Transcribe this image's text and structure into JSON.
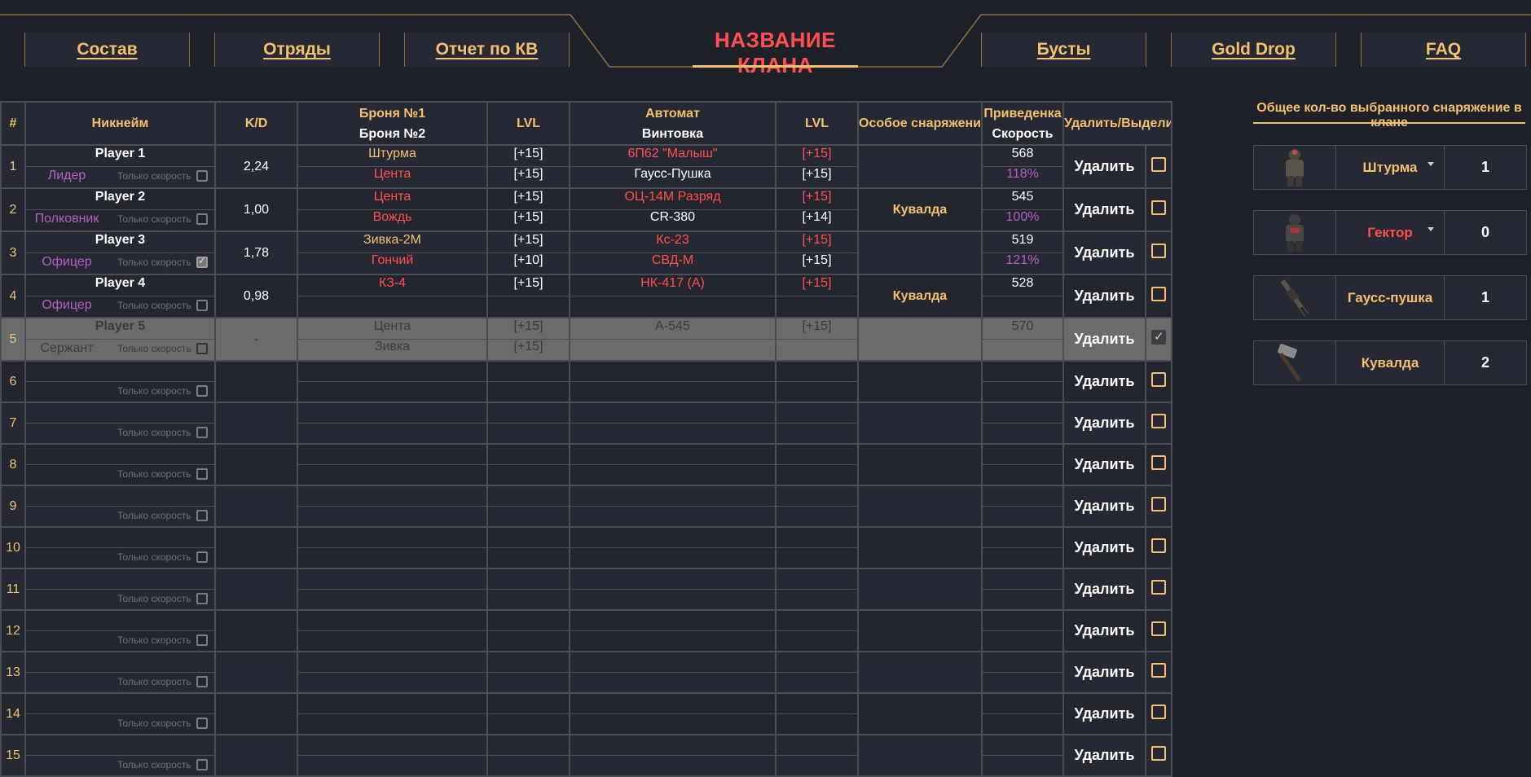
{
  "nav": {
    "tabs": [
      {
        "label": "Состав"
      },
      {
        "label": "Отряды"
      },
      {
        "label": "Отчет по КВ"
      },
      {
        "label": "Бусты"
      },
      {
        "label": "Gold Drop"
      },
      {
        "label": "FAQ"
      }
    ],
    "clan_title": "НАЗВАНИЕ КЛАНА"
  },
  "table": {
    "headers": {
      "num": "#",
      "nick": "Никнейм",
      "kd": "K/D",
      "armor1": "Броня №1",
      "armor2": "Броня №2",
      "lvl": "LVL",
      "rifle": "Автомат",
      "sniper": "Винтовка",
      "lvl2": "LVL",
      "special": "Особое снаряжение",
      "reduced": "Приведенка",
      "speed": "Скорость",
      "actions": "Удалить/Выделить"
    },
    "speed_only_label": "Только скорость",
    "delete_label": "Удалить",
    "rows": [
      {
        "num": "1",
        "name": "Player 1",
        "rank": "Лидер",
        "kd": "2,24",
        "armor1": "Штурма",
        "armor2": "Цента",
        "alvl1": "[+15]",
        "alvl2": "[+15]",
        "w1": "6П62 \"Малыш\"",
        "w2": "Гаусс-Пушка",
        "wlvl1": "[+15]",
        "wlvl2": "[+15]",
        "special": "",
        "reduced": "568",
        "speed": "118%",
        "speed_only": false,
        "selected": false
      },
      {
        "num": "2",
        "name": "Player 2",
        "rank": "Полковник",
        "kd": "1,00",
        "armor1": "Цента",
        "armor2": "Вождь",
        "alvl1": "[+15]",
        "alvl2": "[+15]",
        "w1": "ОЦ-14М Разряд",
        "w2": "CR-380",
        "wlvl1": "[+15]",
        "wlvl2": "[+14]",
        "special": "Кувалда",
        "reduced": "545",
        "speed": "100%",
        "speed_only": false,
        "selected": false
      },
      {
        "num": "3",
        "name": "Player 3",
        "rank": "Офицер",
        "kd": "1,78",
        "armor1": "Зивка-2М",
        "armor2": "Гончий",
        "alvl1": "[+15]",
        "alvl2": "[+10]",
        "w1": "Кс-23",
        "w2": "СВД-М",
        "wlvl1": "[+15]",
        "wlvl2": "[+15]",
        "special": "",
        "reduced": "519",
        "speed": "121%",
        "speed_only": true,
        "selected": false
      },
      {
        "num": "4",
        "name": "Player 4",
        "rank": "Офицер",
        "kd": "0,98",
        "armor1": "КЗ-4",
        "armor2": "",
        "alvl1": "[+15]",
        "alvl2": "",
        "w1": "НК-417 (А)",
        "w2": "",
        "wlvl1": "[+15]",
        "wlvl2": "",
        "special": "Кувалда",
        "reduced": "528",
        "speed": "",
        "speed_only": false,
        "selected": false
      },
      {
        "num": "5",
        "name": "Player 5",
        "rank": "Сержант",
        "kd": "-",
        "armor1": "Цента",
        "armor2": "Зивка",
        "alvl1": "[+15]",
        "alvl2": "[+15]",
        "w1": "А-545",
        "w2": "",
        "wlvl1": "[+15]",
        "wlvl2": "",
        "special": "",
        "reduced": "570",
        "speed": "",
        "speed_only": false,
        "selected": true
      },
      {
        "num": "6",
        "empty": true
      },
      {
        "num": "7",
        "empty": true
      },
      {
        "num": "8",
        "empty": true
      },
      {
        "num": "9",
        "empty": true
      },
      {
        "num": "10",
        "empty": true
      },
      {
        "num": "11",
        "empty": true
      },
      {
        "num": "12",
        "empty": true
      },
      {
        "num": "13",
        "empty": true
      },
      {
        "num": "14",
        "empty": true
      },
      {
        "num": "15",
        "empty": true
      }
    ]
  },
  "summary": {
    "title": "Общее кол-во выбранного снаряжение в клане",
    "items": [
      {
        "name": "Штурма",
        "count": "1",
        "color": "#f2c06e",
        "dropdown": true,
        "icon": "armor-icon"
      },
      {
        "name": "Гектор",
        "count": "0",
        "color": "#ff4f4f",
        "dropdown": true,
        "icon": "armor-icon"
      },
      {
        "name": "Гаусс-пушка",
        "count": "1",
        "color": "#f2c06e",
        "dropdown": false,
        "icon": "rifle-icon"
      },
      {
        "name": "Кувалда",
        "count": "2",
        "color": "#f2c06e",
        "dropdown": false,
        "icon": "sledgehammer-icon"
      }
    ]
  },
  "colors": {
    "accent": "#f2c06e",
    "danger": "#ff4f4f",
    "purple": "#b35fc3",
    "bg": "#1f2129"
  }
}
